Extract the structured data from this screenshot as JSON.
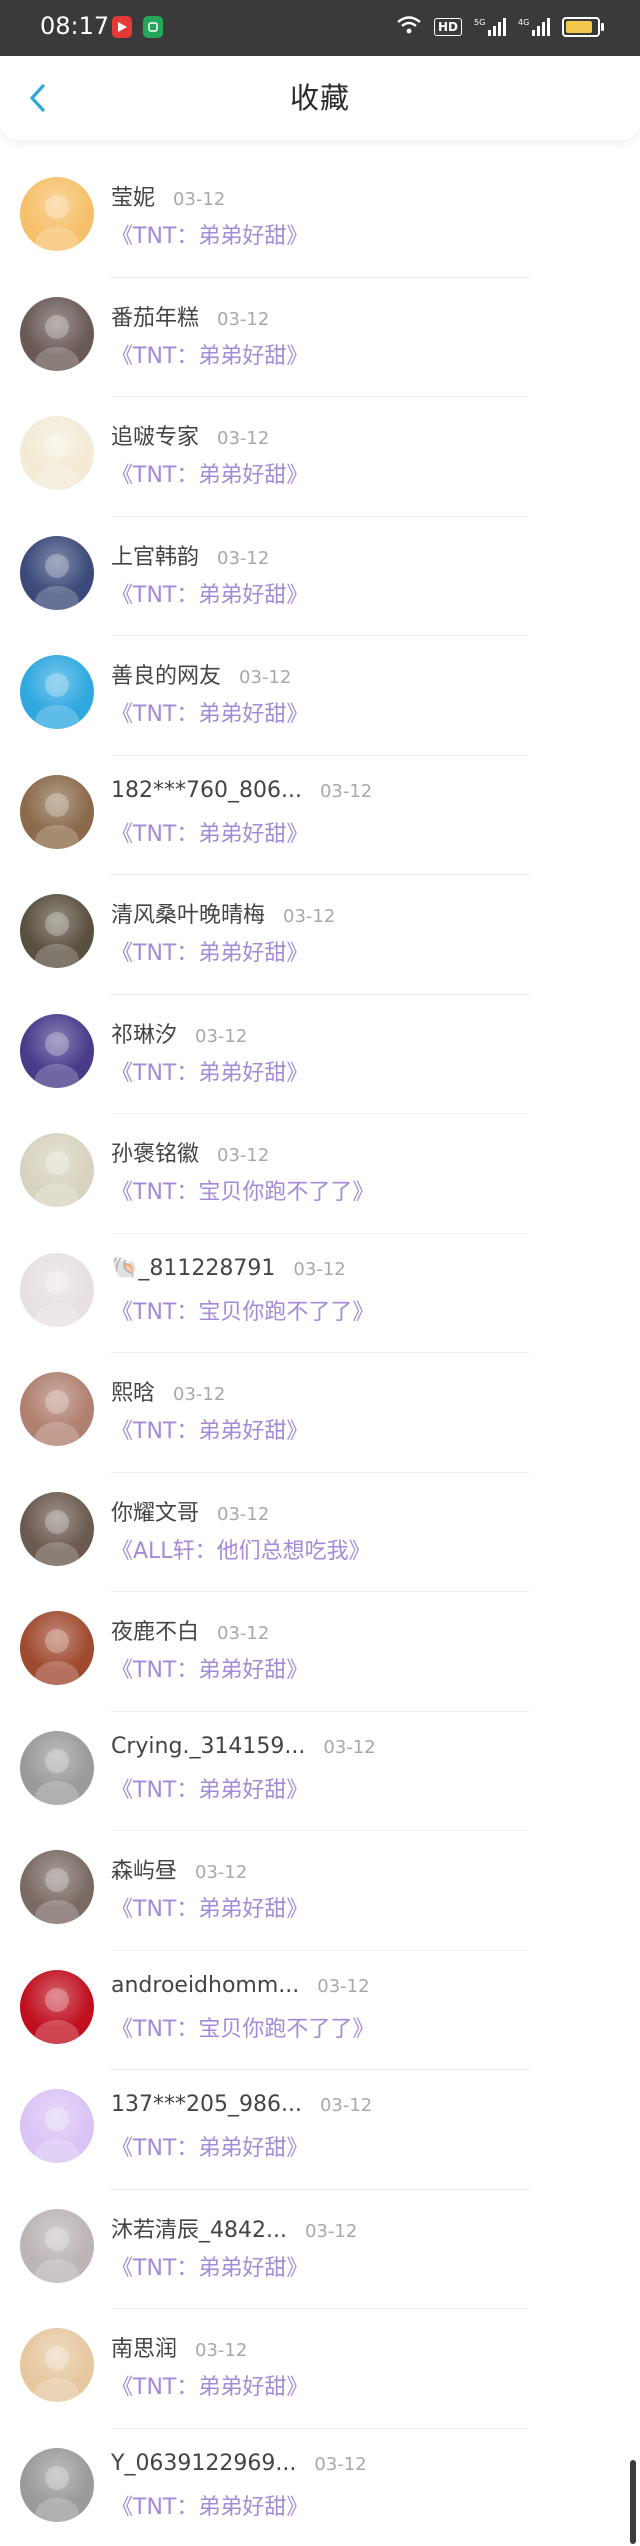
{
  "status_bar": {
    "time": "08:17",
    "hd_label": "HD",
    "signal_label_1": "5G",
    "signal_label_2": "4G",
    "battery_level": 0.85,
    "colors": {
      "background": "#3a3a3a",
      "battery": "#f2c94c"
    }
  },
  "nav": {
    "back_icon": "chevron-left-icon",
    "title": "收藏"
  },
  "accent_colors": {
    "back": "#2fa8d8",
    "work_title": "#a58ad8",
    "date": "#a8a8a8"
  },
  "items": [
    {
      "name": "莹妮",
      "date": "03-12",
      "work": "《TNT：弟弟好甜》",
      "avatar_color": "#f6c06a"
    },
    {
      "name": "番茄年糕",
      "date": "03-12",
      "work": "《TNT：弟弟好甜》",
      "avatar_color": "#6a5a56"
    },
    {
      "name": "追啵专家",
      "date": "03-12",
      "work": "《TNT：弟弟好甜》",
      "avatar_color": "#f3ebd6"
    },
    {
      "name": "上官韩韵",
      "date": "03-12",
      "work": "《TNT：弟弟好甜》",
      "avatar_color": "#3b4a7a"
    },
    {
      "name": "善良的网友",
      "date": "03-12",
      "work": "《TNT：弟弟好甜》",
      "avatar_color": "#2fa8e0"
    },
    {
      "name": "182***760_806...",
      "date": "03-12",
      "work": "《TNT：弟弟好甜》",
      "avatar_color": "#8a6a4a"
    },
    {
      "name": "清风桑叶晚晴梅",
      "date": "03-12",
      "work": "《TNT：弟弟好甜》",
      "avatar_color": "#5a5040"
    },
    {
      "name": "祁琳汐",
      "date": "03-12",
      "work": "《TNT：弟弟好甜》",
      "avatar_color": "#4a3a8a"
    },
    {
      "name": "孙褒铭徽",
      "date": "03-12",
      "work": "《TNT：宝贝你跑不了了》",
      "avatar_color": "#d8d2c0"
    },
    {
      "name": "🐚_811228791",
      "date": "03-12",
      "work": "《TNT：宝贝你跑不了了》",
      "avatar_color": "#e8e0e0"
    },
    {
      "name": "熙晗",
      "date": "03-12",
      "work": "《TNT：弟弟好甜》",
      "avatar_color": "#b08070"
    },
    {
      "name": "你耀文哥",
      "date": "03-12",
      "work": "《ALL轩：他们总想吃我》",
      "avatar_color": "#6a5a50"
    },
    {
      "name": "夜鹿不白",
      "date": "03-12",
      "work": "《TNT：弟弟好甜》",
      "avatar_color": "#a04a30"
    },
    {
      "name": "Crying._314159...",
      "date": "03-12",
      "work": "《TNT：弟弟好甜》",
      "avatar_color": "#9a9a9a"
    },
    {
      "name": "森屿昼",
      "date": "03-12",
      "work": "《TNT：弟弟好甜》",
      "avatar_color": "#7a6a64"
    },
    {
      "name": "androeidhomm...",
      "date": "03-12",
      "work": "《TNT：宝贝你跑不了了》",
      "avatar_color": "#c01020"
    },
    {
      "name": "137***205_986...",
      "date": "03-12",
      "work": "《TNT：弟弟好甜》",
      "avatar_color": "#d9c4f5"
    },
    {
      "name": "沐若清辰_4842...",
      "date": "03-12",
      "work": "《TNT：弟弟好甜》",
      "avatar_color": "#bdb4b4"
    },
    {
      "name": "南思润",
      "date": "03-12",
      "work": "《TNT：弟弟好甜》",
      "avatar_color": "#e6c8a0"
    },
    {
      "name": "Y_0639122969...",
      "date": "03-12",
      "work": "《TNT：弟弟好甜》",
      "avatar_color": "#9a9a9a"
    }
  ]
}
